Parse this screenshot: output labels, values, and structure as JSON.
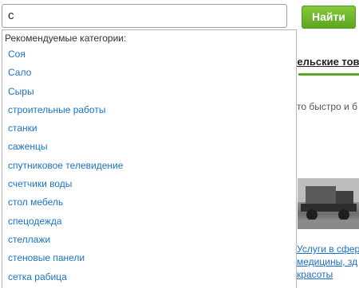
{
  "search": {
    "value": "с",
    "button_label": "Найти"
  },
  "background": {
    "heading": "тельские тов",
    "text": "то быстро и б",
    "links": [
      "Услуги в сфер",
      "медицины, зд",
      "красоты"
    ]
  },
  "dropdown": {
    "title": "Рекомендуемые категории:",
    "items": [
      "Соя",
      "Сало",
      "Сыры",
      "строительные работы",
      "станки",
      "саженцы",
      "спутниковое телевидение",
      "счетчики воды",
      "стол мебель",
      "спецодежда",
      "стеллажи",
      "стеновые панели",
      "сетка рабица"
    ]
  },
  "colors": {
    "accent_green": "#5ea621",
    "link_blue": "#1a73c6"
  }
}
